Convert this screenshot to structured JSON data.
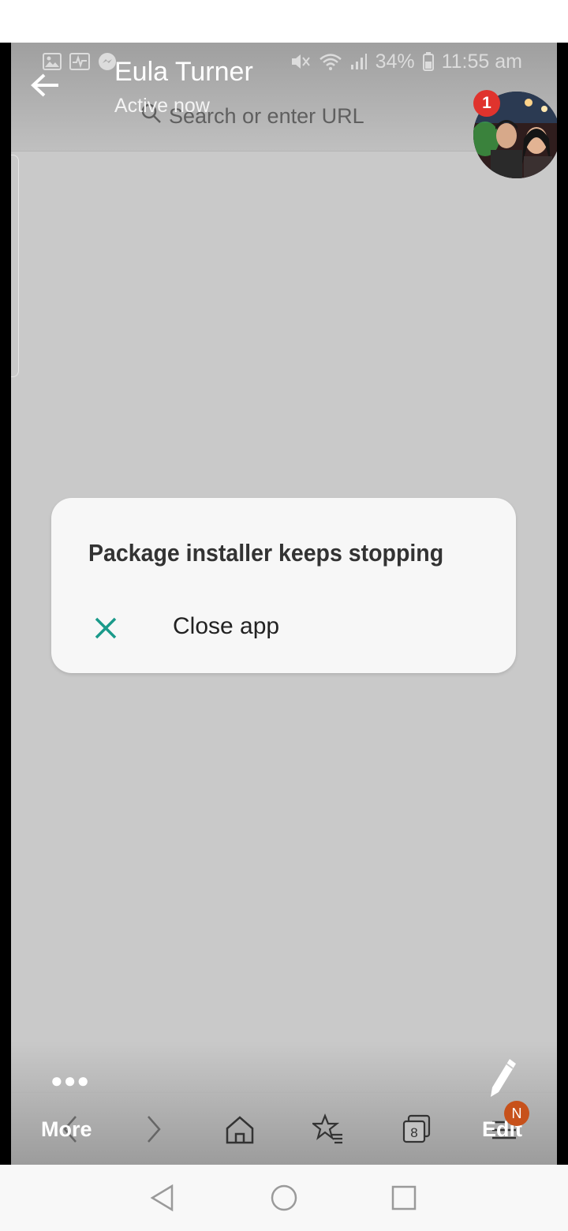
{
  "status_bar": {
    "battery": "34%",
    "time": "11:55 am"
  },
  "chat_head": {
    "name": "Eula Turner",
    "status": "Active now",
    "unread_count": "1"
  },
  "browser": {
    "search_placeholder": "Search or enter URL",
    "toolbar": {
      "more_label": "More",
      "edit_label": "Edit",
      "tabs_count": "8",
      "notification_letter": "N"
    }
  },
  "dialog": {
    "title": "Package installer keeps stopping",
    "action_label": "Close app"
  },
  "colors": {
    "accent_teal": "#1a9a8a",
    "badge_red": "#e0332d",
    "badge_orange": "#c7511b"
  },
  "icons": [
    "picture-icon",
    "activity-icon",
    "messenger-icon",
    "mute-icon",
    "wifi-icon",
    "signal-icon",
    "battery-icon",
    "back-arrow-icon",
    "search-icon",
    "close-icon",
    "pencil-icon",
    "nav-back-icon",
    "nav-forward-icon",
    "home-icon",
    "bookmarks-icon",
    "tabs-icon",
    "menu-icon",
    "system-back-icon",
    "system-home-icon",
    "system-recents-icon"
  ]
}
